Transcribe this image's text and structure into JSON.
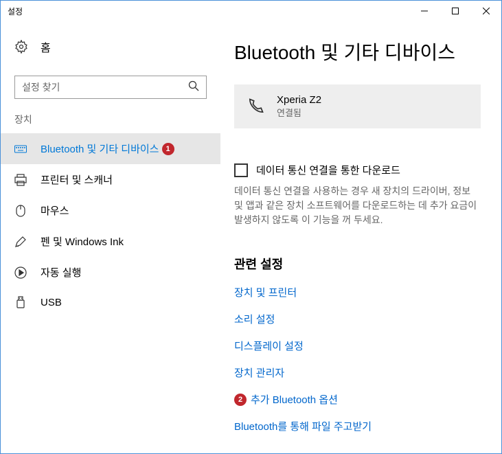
{
  "window": {
    "title": "설정"
  },
  "sidebar": {
    "home_label": "홈",
    "search_placeholder": "설정 찾기",
    "section_label": "장치",
    "items": [
      {
        "label": "Bluetooth 및 기타 디바이스",
        "icon": "keyboard",
        "active": true,
        "badge": "1"
      },
      {
        "label": "프린터 및 스캐너",
        "icon": "printer"
      },
      {
        "label": "마우스",
        "icon": "mouse"
      },
      {
        "label": "펜 및 Windows Ink",
        "icon": "pen"
      },
      {
        "label": "자동 실행",
        "icon": "autoplay"
      },
      {
        "label": "USB",
        "icon": "usb"
      }
    ]
  },
  "main": {
    "title": "Bluetooth 및 기타 디바이스",
    "device": {
      "name": "Xperia Z2",
      "status": "연결됨"
    },
    "checkbox": {
      "label": "데이터 통신 연결을 통한 다운로드",
      "description": "데이터 통신 연결을 사용하는 경우 새 장치의 드라이버, 정보 및 앱과 같은 장치 소프트웨어를 다운로드하는 데 추가 요금이 발생하지 않도록 이 기능을 꺼 두세요."
    },
    "related": {
      "heading": "관련 설정",
      "links": [
        {
          "label": "장치 및 프린터"
        },
        {
          "label": "소리 설정"
        },
        {
          "label": "디스플레이 설정"
        },
        {
          "label": "장치 관리자"
        },
        {
          "label": "추가 Bluetooth 옵션",
          "badge": "2"
        },
        {
          "label": "Bluetooth를 통해 파일 주고받기"
        }
      ]
    }
  }
}
